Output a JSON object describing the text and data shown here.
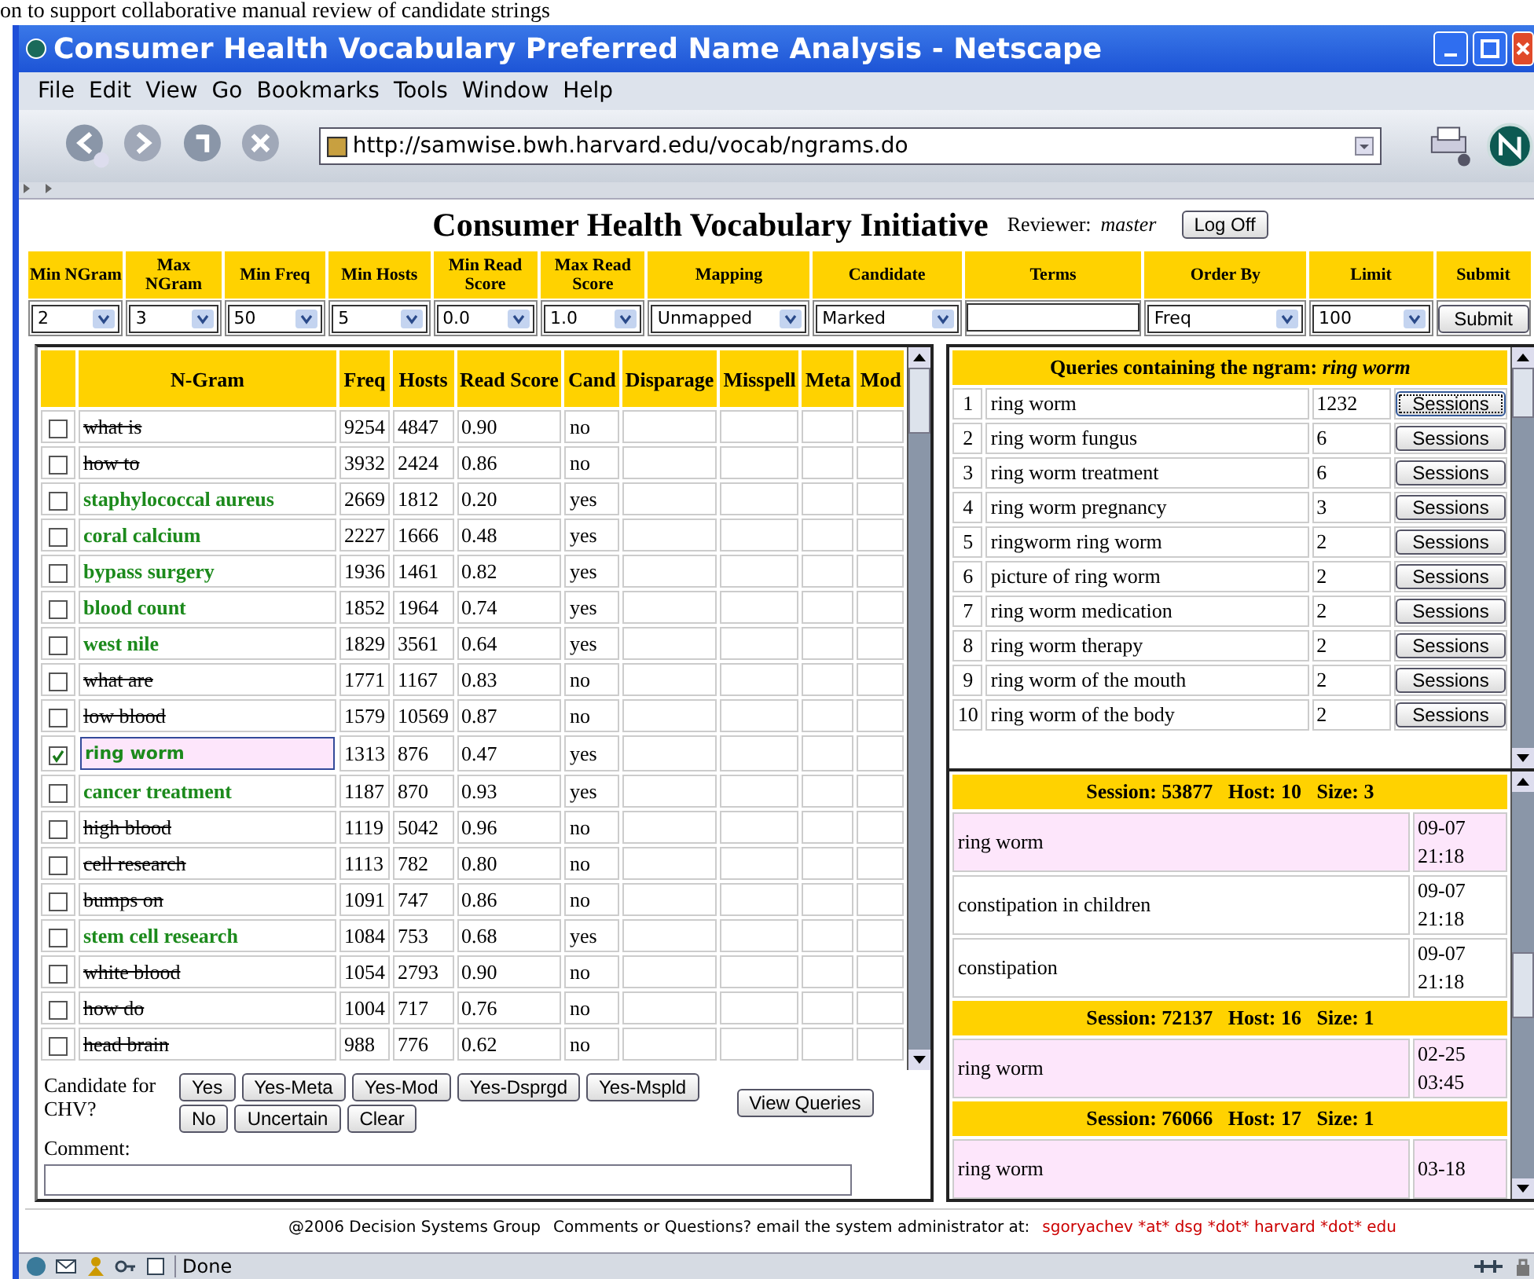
{
  "caption": "on to support collaborative manual review of candidate strings",
  "window": {
    "title": "Consumer Health Vocabulary Preferred Name Analysis - Netscape"
  },
  "menu": [
    "File",
    "Edit",
    "View",
    "Go",
    "Bookmarks",
    "Tools",
    "Window",
    "Help"
  ],
  "address": "http://samwise.bwh.harvard.edu/vocab/ngrams.do",
  "page": {
    "heading": "Consumer Health Vocabulary Initiative",
    "reviewer_label": "Reviewer:",
    "reviewer": "master",
    "logoff": "Log Off"
  },
  "filters": [
    {
      "label": "Min NGram",
      "kind": "select",
      "value": "2"
    },
    {
      "label": "Max NGram",
      "kind": "select",
      "value": "3"
    },
    {
      "label": "Min Freq",
      "kind": "select",
      "value": "50"
    },
    {
      "label": "Min Hosts",
      "kind": "select",
      "value": "5"
    },
    {
      "label": "Min Read Score",
      "kind": "select",
      "value": "0.0"
    },
    {
      "label": "Max Read Score",
      "kind": "select",
      "value": "1.0"
    },
    {
      "label": "Mapping",
      "kind": "select",
      "value": "Unmapped"
    },
    {
      "label": "Candidate",
      "kind": "select",
      "value": "Marked"
    },
    {
      "label": "Terms",
      "kind": "text"
    },
    {
      "label": "Order By",
      "kind": "select",
      "value": "Freq"
    },
    {
      "label": "Limit",
      "kind": "select",
      "value": "100"
    },
    {
      "label": "Submit",
      "kind": "button",
      "value": "Submit"
    }
  ],
  "ngram_table": {
    "columns": [
      "N-Gram",
      "Freq",
      "Hosts",
      "Read Score",
      "Cand",
      "Disparage",
      "Misspell",
      "Meta",
      "Mod"
    ],
    "rows": [
      {
        "ngram": "what is",
        "freq": "9254",
        "hosts": "4847",
        "score": "0.90",
        "cand": "no",
        "kind": "rejected",
        "checked": false,
        "selected": false
      },
      {
        "ngram": "how to",
        "freq": "3932",
        "hosts": "2424",
        "score": "0.86",
        "cand": "no",
        "kind": "rejected",
        "checked": false,
        "selected": false
      },
      {
        "ngram": "staphylococcal aureus",
        "freq": "2669",
        "hosts": "1812",
        "score": "0.20",
        "cand": "yes",
        "kind": "accepted",
        "checked": false,
        "selected": false
      },
      {
        "ngram": "coral calcium",
        "freq": "2227",
        "hosts": "1666",
        "score": "0.48",
        "cand": "yes",
        "kind": "accepted",
        "checked": false,
        "selected": false
      },
      {
        "ngram": "bypass surgery",
        "freq": "1936",
        "hosts": "1461",
        "score": "0.82",
        "cand": "yes",
        "kind": "accepted",
        "checked": false,
        "selected": false
      },
      {
        "ngram": "blood count",
        "freq": "1852",
        "hosts": "1964",
        "score": "0.74",
        "cand": "yes",
        "kind": "accepted",
        "checked": false,
        "selected": false
      },
      {
        "ngram": "west nile",
        "freq": "1829",
        "hosts": "3561",
        "score": "0.64",
        "cand": "yes",
        "kind": "accepted",
        "checked": false,
        "selected": false
      },
      {
        "ngram": "what are",
        "freq": "1771",
        "hosts": "1167",
        "score": "0.83",
        "cand": "no",
        "kind": "rejected",
        "checked": false,
        "selected": false
      },
      {
        "ngram": "low blood",
        "freq": "1579",
        "hosts": "10569",
        "score": "0.87",
        "cand": "no",
        "kind": "rejected",
        "checked": false,
        "selected": false
      },
      {
        "ngram": "ring worm",
        "freq": "1313",
        "hosts": "876",
        "score": "0.47",
        "cand": "yes",
        "kind": "accepted",
        "checked": true,
        "selected": true
      },
      {
        "ngram": "cancer treatment",
        "freq": "1187",
        "hosts": "870",
        "score": "0.93",
        "cand": "yes",
        "kind": "accepted",
        "checked": false,
        "selected": false
      },
      {
        "ngram": "high blood",
        "freq": "1119",
        "hosts": "5042",
        "score": "0.96",
        "cand": "no",
        "kind": "rejected",
        "checked": false,
        "selected": false
      },
      {
        "ngram": "cell research",
        "freq": "1113",
        "hosts": "782",
        "score": "0.80",
        "cand": "no",
        "kind": "rejected",
        "checked": false,
        "selected": false
      },
      {
        "ngram": "bumps on",
        "freq": "1091",
        "hosts": "747",
        "score": "0.86",
        "cand": "no",
        "kind": "rejected",
        "checked": false,
        "selected": false
      },
      {
        "ngram": "stem cell research",
        "freq": "1084",
        "hosts": "753",
        "score": "0.68",
        "cand": "yes",
        "kind": "accepted",
        "checked": false,
        "selected": false
      },
      {
        "ngram": "white blood",
        "freq": "1054",
        "hosts": "2793",
        "score": "0.90",
        "cand": "no",
        "kind": "rejected",
        "checked": false,
        "selected": false
      },
      {
        "ngram": "how do",
        "freq": "1004",
        "hosts": "717",
        "score": "0.76",
        "cand": "no",
        "kind": "rejected",
        "checked": false,
        "selected": false
      },
      {
        "ngram": "head brain",
        "freq": "988",
        "hosts": "776",
        "score": "0.62",
        "cand": "no",
        "kind": "rejected",
        "checked": false,
        "selected": false
      }
    ]
  },
  "review": {
    "label": "Candidate for CHV?",
    "buttons_row1": [
      "Yes",
      "Yes-Meta",
      "Yes-Mod",
      "Yes-Dsprgd",
      "Yes-Mspld"
    ],
    "buttons_row2": [
      "No",
      "Uncertain",
      "Clear"
    ],
    "view_queries": "View Queries",
    "comment_label": "Comment:"
  },
  "queries": {
    "title": "Queries containing the ngram:",
    "ngram": "ring worm",
    "rows": [
      {
        "num": "1",
        "query": "ring worm",
        "count": "1232",
        "button": "Sessions",
        "focused": true
      },
      {
        "num": "2",
        "query": "ring worm fungus",
        "count": "6",
        "button": "Sessions",
        "focused": false
      },
      {
        "num": "3",
        "query": "ring worm treatment",
        "count": "6",
        "button": "Sessions",
        "focused": false
      },
      {
        "num": "4",
        "query": "ring worm pregnancy",
        "count": "3",
        "button": "Sessions",
        "focused": false
      },
      {
        "num": "5",
        "query": "ringworm ring worm",
        "count": "2",
        "button": "Sessions",
        "focused": false
      },
      {
        "num": "6",
        "query": "picture of ring worm",
        "count": "2",
        "button": "Sessions",
        "focused": false
      },
      {
        "num": "7",
        "query": "ring worm medication",
        "count": "2",
        "button": "Sessions",
        "focused": false
      },
      {
        "num": "8",
        "query": "ring worm therapy",
        "count": "2",
        "button": "Sessions",
        "focused": false
      },
      {
        "num": "9",
        "query": "ring worm of the mouth",
        "count": "2",
        "button": "Sessions",
        "focused": false
      },
      {
        "num": "10",
        "query": "ring worm of the body",
        "count": "2",
        "button": "Sessions",
        "focused": false
      }
    ]
  },
  "sessions": [
    {
      "session": "Session: 53877",
      "host": "Host: 10",
      "size": "Size: 3",
      "entries": [
        {
          "query": "ring worm",
          "date": "09-07",
          "time": "21:18",
          "highlighted": true
        },
        {
          "query": "constipation in children",
          "date": "09-07",
          "time": "21:18",
          "highlighted": false
        },
        {
          "query": "constipation",
          "date": "09-07",
          "time": "21:18",
          "highlighted": false
        }
      ]
    },
    {
      "session": "Session: 72137",
      "host": "Host: 16",
      "size": "Size: 1",
      "entries": [
        {
          "query": "ring worm",
          "date": "02-25",
          "time": "03:45",
          "highlighted": true
        }
      ]
    },
    {
      "session": "Session: 76066",
      "host": "Host: 17",
      "size": "Size: 1",
      "entries": [
        {
          "query": "ring worm",
          "date": "03-18",
          "highlighted": true
        }
      ]
    }
  ],
  "footer": {
    "copyright": "@2006 Decision Systems Group",
    "contact": "Comments or Questions? email the system administrator at:",
    "email": "sgoryachev *at* dsg *dot* harvard *dot* edu"
  },
  "status_bar": {
    "text": "Done"
  }
}
